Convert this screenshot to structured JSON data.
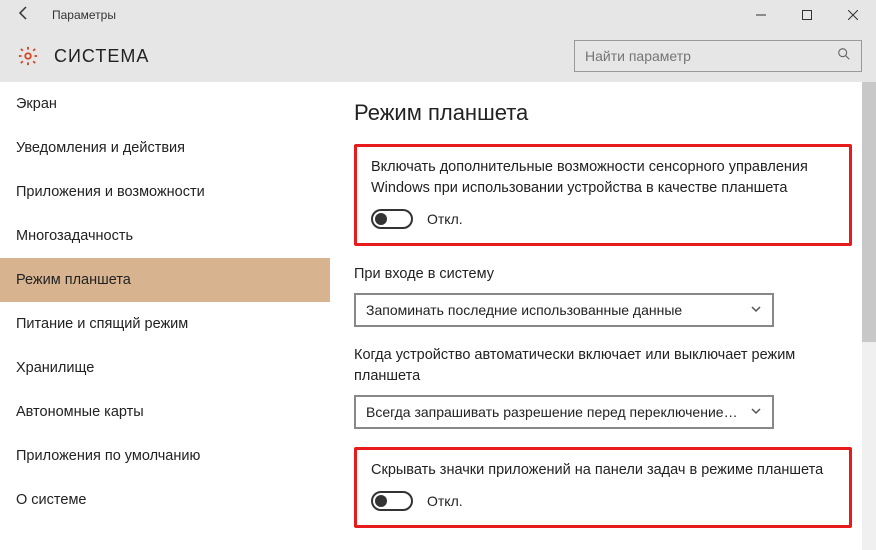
{
  "window": {
    "title": "Параметры"
  },
  "header": {
    "section": "СИСТЕМА",
    "search_placeholder": "Найти параметр"
  },
  "sidebar": {
    "items": [
      {
        "label": "Экран"
      },
      {
        "label": "Уведомления и действия"
      },
      {
        "label": "Приложения и возможности"
      },
      {
        "label": "Многозадачность"
      },
      {
        "label": "Режим планшета",
        "selected": true
      },
      {
        "label": "Питание и спящий режим"
      },
      {
        "label": "Хранилище"
      },
      {
        "label": "Автономные карты"
      },
      {
        "label": "Приложения по умолчанию"
      },
      {
        "label": "О системе"
      }
    ]
  },
  "main": {
    "title": "Режим планшета",
    "toggle1": {
      "label": "Включать дополнительные возможности сенсорного управления Windows при использовании устройства в качестве планшета",
      "state": "Откл."
    },
    "signin": {
      "label": "При входе в систему",
      "value": "Запоминать последние использованные данные"
    },
    "autoswitch": {
      "label": "Когда устройство автоматически включает или выключает режим планшета",
      "value": "Всегда запрашивать разрешение перед переключением…"
    },
    "toggle2": {
      "label": "Скрывать значки приложений на панели задач в режиме планшета",
      "state": "Откл."
    }
  }
}
